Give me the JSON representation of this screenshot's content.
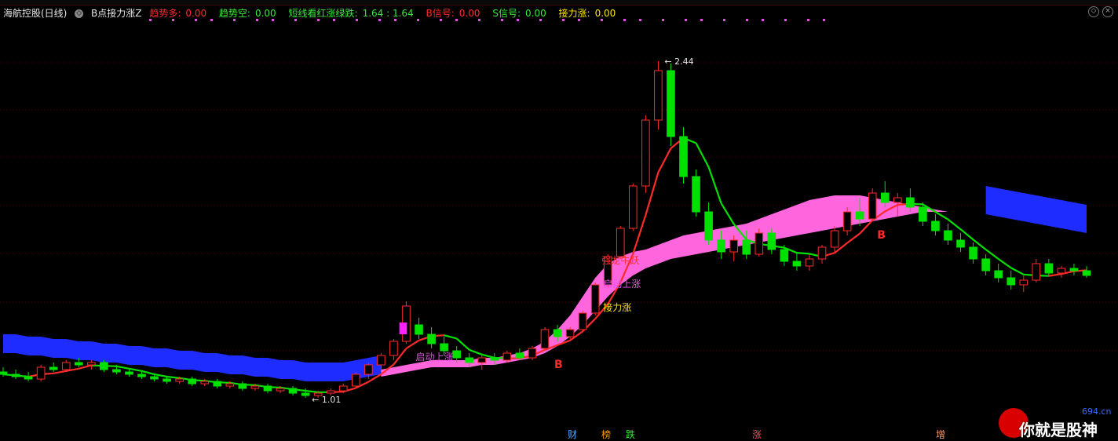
{
  "header": {
    "stock": "海航控股(日线)",
    "circle_icon_glyph": "◇",
    "indicator": "B点接力涨Z",
    "values": [
      {
        "label": "趋势多:",
        "value": "0.00",
        "color": "red"
      },
      {
        "label": "趋势空:",
        "value": "0.00",
        "color": "green"
      },
      {
        "label": "短线看红涨绿跌:",
        "value": "1.64 : 1.64",
        "color": "green"
      },
      {
        "label": "B信号:",
        "value": "0.00",
        "color": "red"
      },
      {
        "label": "S信号:",
        "value": "0.00",
        "color": "green"
      },
      {
        "label": "接力涨:",
        "value": "0.00",
        "color": "yellow"
      }
    ]
  },
  "window_icons": [
    "settings-icon",
    "close-icon"
  ],
  "annotations": {
    "high": "2.44",
    "low": "1.01",
    "signal_b1": "B",
    "signal_b2": "B",
    "qidong1": "启动上涨",
    "qidong2": "启动上涨",
    "jieli": "接力涨",
    "longfei": "强龙牛跃"
  },
  "bottom_labels": [
    {
      "text": "财",
      "color": "#4da6ff"
    },
    {
      "text": "榜",
      "color": "#ff9900"
    },
    {
      "text": "跌",
      "color": "#39e83a"
    },
    {
      "text": "涨",
      "color": "#ff4d4d"
    },
    {
      "text": "增",
      "color": "#ff9966"
    }
  ],
  "watermark": {
    "site": "694.cn",
    "slogan": "你就是股神"
  },
  "colors": {
    "up": "#ff2a2a",
    "down": "#00e100",
    "band": "#ff66dd",
    "blue": "#1f2cff",
    "grid": "#5a0000",
    "bg": "#000000"
  },
  "chart_data": {
    "type": "candlestick",
    "title": "海航控股(日线)",
    "ylim": [
      0.9,
      2.6
    ],
    "price_high": 2.44,
    "price_low": 1.01,
    "candles": [
      {
        "o": 1.12,
        "h": 1.14,
        "l": 1.1,
        "c": 1.11
      },
      {
        "o": 1.11,
        "h": 1.13,
        "l": 1.09,
        "c": 1.1
      },
      {
        "o": 1.1,
        "h": 1.12,
        "l": 1.08,
        "c": 1.09
      },
      {
        "o": 1.09,
        "h": 1.15,
        "l": 1.08,
        "c": 1.14
      },
      {
        "o": 1.14,
        "h": 1.16,
        "l": 1.12,
        "c": 1.13
      },
      {
        "o": 1.13,
        "h": 1.17,
        "l": 1.12,
        "c": 1.16
      },
      {
        "o": 1.16,
        "h": 1.18,
        "l": 1.14,
        "c": 1.15
      },
      {
        "o": 1.15,
        "h": 1.17,
        "l": 1.13,
        "c": 1.16
      },
      {
        "o": 1.16,
        "h": 1.17,
        "l": 1.12,
        "c": 1.13
      },
      {
        "o": 1.13,
        "h": 1.15,
        "l": 1.11,
        "c": 1.12
      },
      {
        "o": 1.12,
        "h": 1.13,
        "l": 1.1,
        "c": 1.11
      },
      {
        "o": 1.11,
        "h": 1.12,
        "l": 1.09,
        "c": 1.1
      },
      {
        "o": 1.1,
        "h": 1.11,
        "l": 1.08,
        "c": 1.09
      },
      {
        "o": 1.09,
        "h": 1.1,
        "l": 1.07,
        "c": 1.08
      },
      {
        "o": 1.08,
        "h": 1.1,
        "l": 1.07,
        "c": 1.09
      },
      {
        "o": 1.09,
        "h": 1.1,
        "l": 1.06,
        "c": 1.07
      },
      {
        "o": 1.07,
        "h": 1.09,
        "l": 1.06,
        "c": 1.08
      },
      {
        "o": 1.08,
        "h": 1.09,
        "l": 1.05,
        "c": 1.06
      },
      {
        "o": 1.06,
        "h": 1.08,
        "l": 1.05,
        "c": 1.07
      },
      {
        "o": 1.07,
        "h": 1.08,
        "l": 1.04,
        "c": 1.05
      },
      {
        "o": 1.05,
        "h": 1.07,
        "l": 1.04,
        "c": 1.06
      },
      {
        "o": 1.06,
        "h": 1.07,
        "l": 1.03,
        "c": 1.04
      },
      {
        "o": 1.04,
        "h": 1.06,
        "l": 1.03,
        "c": 1.05
      },
      {
        "o": 1.05,
        "h": 1.06,
        "l": 1.02,
        "c": 1.03
      },
      {
        "o": 1.03,
        "h": 1.05,
        "l": 1.01,
        "c": 1.02
      },
      {
        "o": 1.02,
        "h": 1.04,
        "l": 1.01,
        "c": 1.03
      },
      {
        "o": 1.03,
        "h": 1.05,
        "l": 1.02,
        "c": 1.04
      },
      {
        "o": 1.04,
        "h": 1.07,
        "l": 1.03,
        "c": 1.06
      },
      {
        "o": 1.06,
        "h": 1.12,
        "l": 1.05,
        "c": 1.11
      },
      {
        "o": 1.11,
        "h": 1.16,
        "l": 1.09,
        "c": 1.15
      },
      {
        "o": 1.15,
        "h": 1.2,
        "l": 1.13,
        "c": 1.19
      },
      {
        "o": 1.19,
        "h": 1.26,
        "l": 1.17,
        "c": 1.25
      },
      {
        "o": 1.25,
        "h": 1.42,
        "l": 1.24,
        "c": 1.4
      },
      {
        "o": 1.32,
        "h": 1.35,
        "l": 1.26,
        "c": 1.28
      },
      {
        "o": 1.28,
        "h": 1.31,
        "l": 1.22,
        "c": 1.24
      },
      {
        "o": 1.24,
        "h": 1.27,
        "l": 1.19,
        "c": 1.21
      },
      {
        "o": 1.21,
        "h": 1.23,
        "l": 1.16,
        "c": 1.18
      },
      {
        "o": 1.18,
        "h": 1.2,
        "l": 1.14,
        "c": 1.16
      },
      {
        "o": 1.16,
        "h": 1.19,
        "l": 1.13,
        "c": 1.18
      },
      {
        "o": 1.18,
        "h": 1.2,
        "l": 1.15,
        "c": 1.17
      },
      {
        "o": 1.17,
        "h": 1.21,
        "l": 1.16,
        "c": 1.2
      },
      {
        "o": 1.2,
        "h": 1.22,
        "l": 1.17,
        "c": 1.18
      },
      {
        "o": 1.18,
        "h": 1.23,
        "l": 1.17,
        "c": 1.22
      },
      {
        "o": 1.22,
        "h": 1.31,
        "l": 1.21,
        "c": 1.3
      },
      {
        "o": 1.3,
        "h": 1.32,
        "l": 1.25,
        "c": 1.27
      },
      {
        "o": 1.27,
        "h": 1.31,
        "l": 1.26,
        "c": 1.3
      },
      {
        "o": 1.3,
        "h": 1.38,
        "l": 1.29,
        "c": 1.37
      },
      {
        "o": 1.37,
        "h": 1.5,
        "l": 1.36,
        "c": 1.49
      },
      {
        "o": 1.49,
        "h": 1.62,
        "l": 1.48,
        "c": 1.61
      },
      {
        "o": 1.61,
        "h": 1.74,
        "l": 1.6,
        "c": 1.73
      },
      {
        "o": 1.73,
        "h": 1.92,
        "l": 1.72,
        "c": 1.91
      },
      {
        "o": 1.91,
        "h": 2.21,
        "l": 1.88,
        "c": 2.19
      },
      {
        "o": 2.19,
        "h": 2.44,
        "l": 2.15,
        "c": 2.4
      },
      {
        "o": 2.4,
        "h": 2.43,
        "l": 2.08,
        "c": 2.12
      },
      {
        "o": 2.12,
        "h": 2.16,
        "l": 1.92,
        "c": 1.95
      },
      {
        "o": 1.95,
        "h": 1.98,
        "l": 1.78,
        "c": 1.8
      },
      {
        "o": 1.8,
        "h": 1.84,
        "l": 1.66,
        "c": 1.68
      },
      {
        "o": 1.68,
        "h": 1.72,
        "l": 1.6,
        "c": 1.63
      },
      {
        "o": 1.63,
        "h": 1.7,
        "l": 1.59,
        "c": 1.68
      },
      {
        "o": 1.68,
        "h": 1.72,
        "l": 1.6,
        "c": 1.62
      },
      {
        "o": 1.62,
        "h": 1.73,
        "l": 1.61,
        "c": 1.71
      },
      {
        "o": 1.71,
        "h": 1.73,
        "l": 1.62,
        "c": 1.64
      },
      {
        "o": 1.64,
        "h": 1.66,
        "l": 1.57,
        "c": 1.59
      },
      {
        "o": 1.59,
        "h": 1.63,
        "l": 1.55,
        "c": 1.57
      },
      {
        "o": 1.57,
        "h": 1.62,
        "l": 1.55,
        "c": 1.6
      },
      {
        "o": 1.6,
        "h": 1.66,
        "l": 1.58,
        "c": 1.65
      },
      {
        "o": 1.65,
        "h": 1.74,
        "l": 1.63,
        "c": 1.72
      },
      {
        "o": 1.72,
        "h": 1.82,
        "l": 1.7,
        "c": 1.8
      },
      {
        "o": 1.8,
        "h": 1.86,
        "l": 1.74,
        "c": 1.77
      },
      {
        "o": 1.77,
        "h": 1.9,
        "l": 1.76,
        "c": 1.88
      },
      {
        "o": 1.88,
        "h": 1.93,
        "l": 1.82,
        "c": 1.84
      },
      {
        "o": 1.84,
        "h": 1.88,
        "l": 1.78,
        "c": 1.86
      },
      {
        "o": 1.86,
        "h": 1.9,
        "l": 1.8,
        "c": 1.82
      },
      {
        "o": 1.82,
        "h": 1.84,
        "l": 1.74,
        "c": 1.76
      },
      {
        "o": 1.76,
        "h": 1.79,
        "l": 1.7,
        "c": 1.72
      },
      {
        "o": 1.72,
        "h": 1.75,
        "l": 1.66,
        "c": 1.68
      },
      {
        "o": 1.68,
        "h": 1.71,
        "l": 1.63,
        "c": 1.65
      },
      {
        "o": 1.65,
        "h": 1.67,
        "l": 1.58,
        "c": 1.6
      },
      {
        "o": 1.6,
        "h": 1.62,
        "l": 1.53,
        "c": 1.55
      },
      {
        "o": 1.55,
        "h": 1.58,
        "l": 1.5,
        "c": 1.52
      },
      {
        "o": 1.52,
        "h": 1.55,
        "l": 1.47,
        "c": 1.49
      },
      {
        "o": 1.49,
        "h": 1.53,
        "l": 1.46,
        "c": 1.51
      },
      {
        "o": 1.51,
        "h": 1.6,
        "l": 1.5,
        "c": 1.58
      },
      {
        "o": 1.58,
        "h": 1.6,
        "l": 1.53,
        "c": 1.54
      },
      {
        "o": 1.54,
        "h": 1.57,
        "l": 1.52,
        "c": 1.56
      },
      {
        "o": 1.56,
        "h": 1.58,
        "l": 1.53,
        "c": 1.55
      },
      {
        "o": 1.55,
        "h": 1.57,
        "l": 1.52,
        "c": 1.53
      }
    ],
    "band_lower": [
      1.1,
      1.1,
      1.1,
      1.09,
      1.09,
      1.09,
      1.09,
      1.08,
      1.08,
      1.08,
      1.07,
      1.07,
      1.07,
      1.06,
      1.06,
      1.06,
      1.05,
      1.05,
      1.05,
      1.04,
      1.04,
      1.04,
      1.03,
      1.03,
      1.03,
      1.02,
      1.03,
      1.04,
      1.06,
      1.08,
      1.1,
      1.11,
      1.12,
      1.13,
      1.14,
      1.14,
      1.14,
      1.14,
      1.15,
      1.15,
      1.16,
      1.17,
      1.18,
      1.2,
      1.23,
      1.27,
      1.32,
      1.38,
      1.44,
      1.49,
      1.53,
      1.56,
      1.58,
      1.6,
      1.61,
      1.62,
      1.63,
      1.64,
      1.65,
      1.66,
      1.67,
      1.68,
      1.69,
      1.7,
      1.71,
      1.72,
      1.73,
      1.74,
      1.75,
      1.76,
      1.77,
      1.78,
      1.79,
      1.8,
      1.8,
      1.8,
      1.79,
      1.78,
      1.77,
      1.76,
      1.75,
      1.74,
      1.73,
      1.72,
      1.71,
      1.7,
      1.69,
      1.68,
      1.67
    ],
    "band_upper": [
      1.22,
      1.22,
      1.21,
      1.21,
      1.2,
      1.2,
      1.19,
      1.19,
      1.18,
      1.18,
      1.17,
      1.17,
      1.16,
      1.16,
      1.15,
      1.15,
      1.14,
      1.14,
      1.13,
      1.13,
      1.12,
      1.12,
      1.11,
      1.11,
      1.1,
      1.1,
      1.1,
      1.1,
      1.11,
      1.12,
      1.13,
      1.14,
      1.15,
      1.16,
      1.17,
      1.17,
      1.17,
      1.17,
      1.18,
      1.18,
      1.19,
      1.2,
      1.22,
      1.25,
      1.3,
      1.36,
      1.44,
      1.52,
      1.58,
      1.61,
      1.63,
      1.64,
      1.66,
      1.68,
      1.7,
      1.71,
      1.72,
      1.73,
      1.74,
      1.75,
      1.77,
      1.79,
      1.81,
      1.83,
      1.85,
      1.86,
      1.87,
      1.87,
      1.87,
      1.86,
      1.85,
      1.84,
      1.83,
      1.82,
      1.81,
      1.8,
      1.79,
      1.78,
      1.77,
      1.76,
      1.75,
      1.74,
      1.73,
      1.72,
      1.71,
      1.7,
      1.69,
      1.68,
      1.67
    ]
  }
}
